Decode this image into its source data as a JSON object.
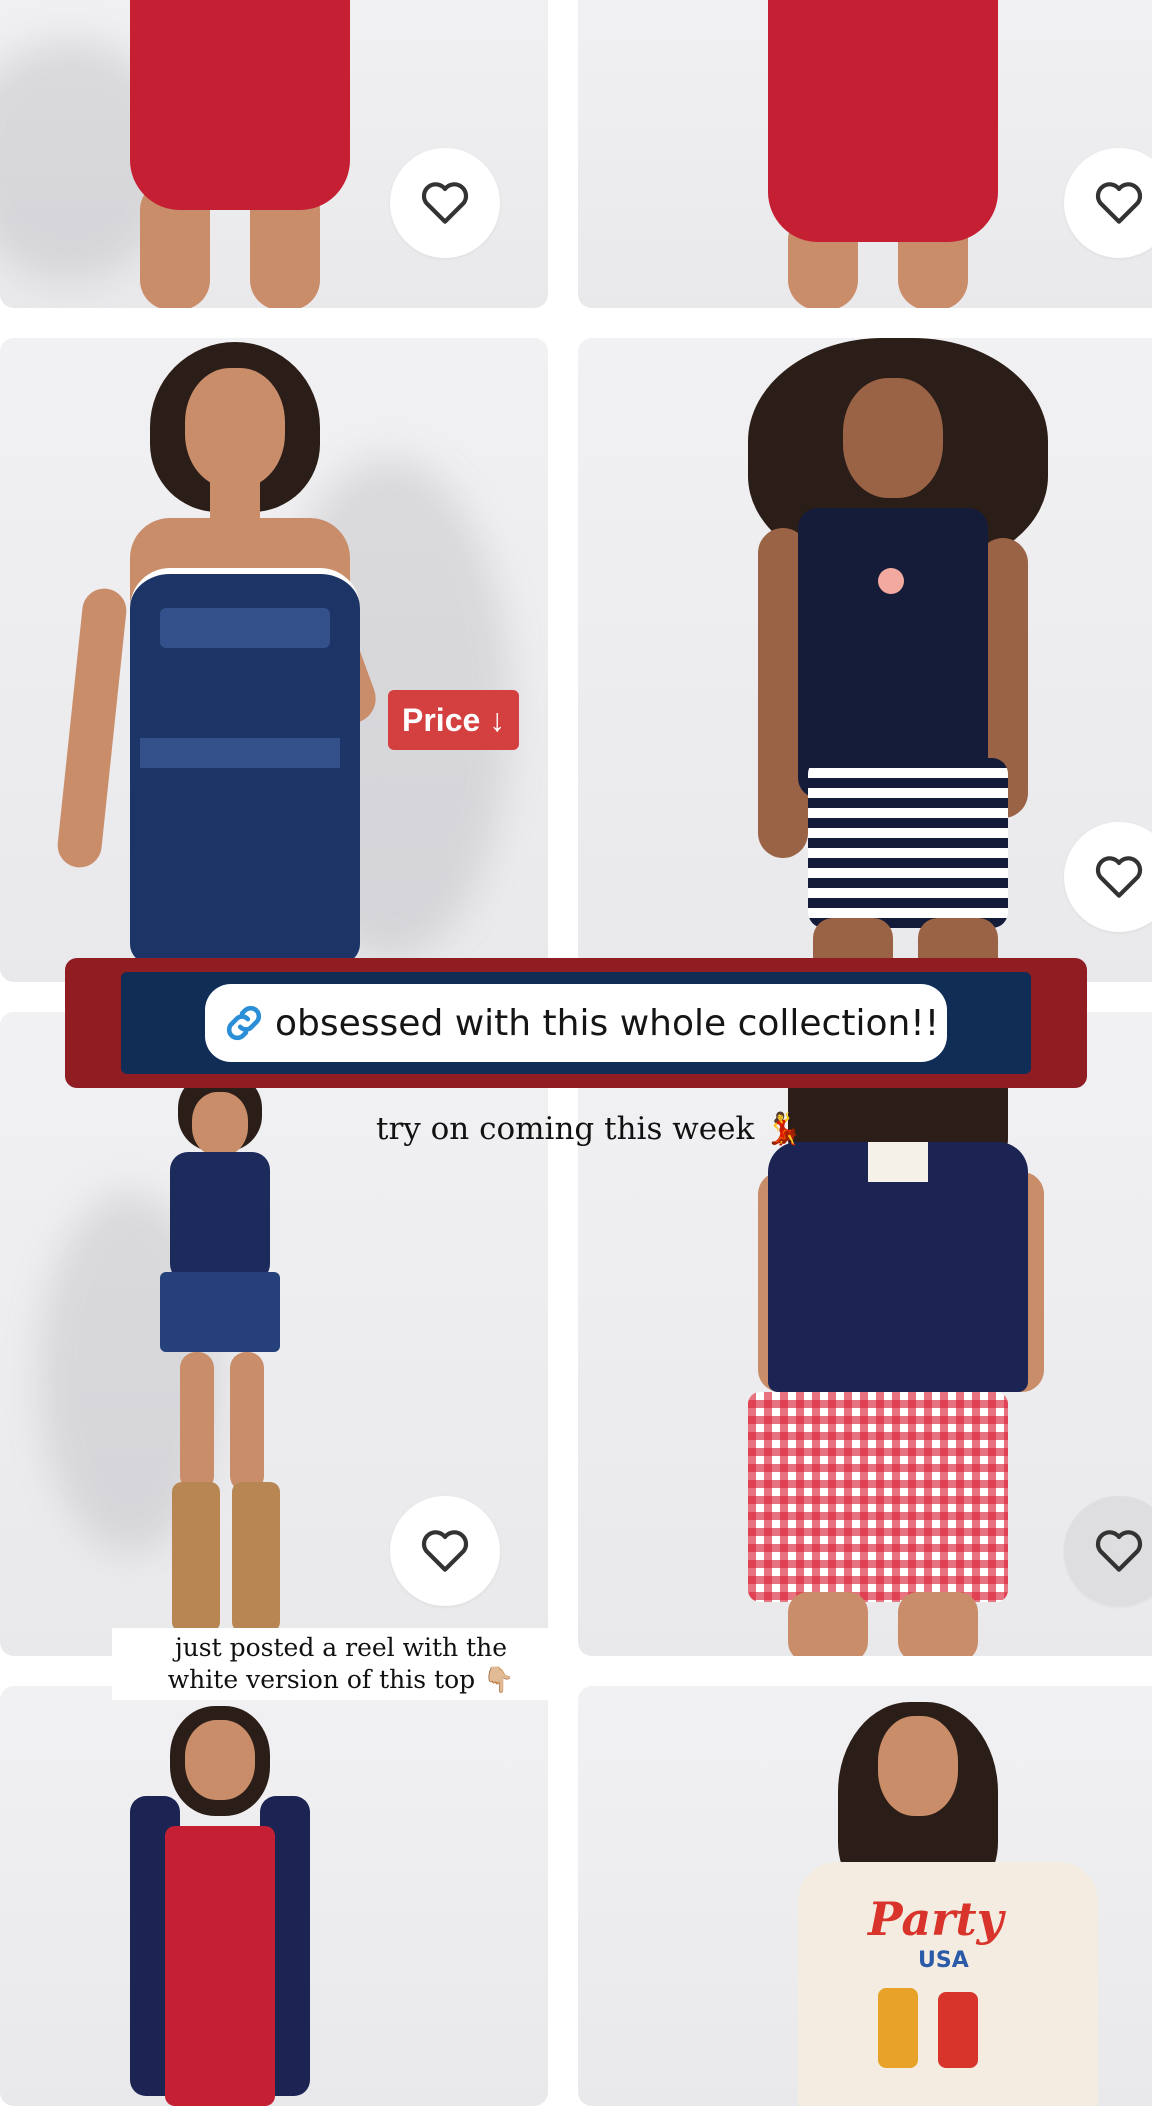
{
  "products": [
    {
      "id": "row1-left",
      "outfit": "red anchor print romper",
      "favorite_icon": "heart-outline-icon"
    },
    {
      "id": "row1-right",
      "outfit": "red anchor print romper",
      "favorite_icon": "heart-outline-icon"
    },
    {
      "id": "row2-left",
      "outfit": "navy bandana print romper",
      "badge": "Price ↓",
      "favorite_icon": "heart-outline-icon"
    },
    {
      "id": "row2-right",
      "outfit": "navy tank with striped shorts",
      "favorite_icon": "heart-outline-icon"
    },
    {
      "id": "row3-left",
      "outfit": "navy halter with bandana skirt",
      "favorite_icon": "heart-outline-icon"
    },
    {
      "id": "row3-right",
      "outfit": "navy polo with red gingham shorts",
      "favorite_icon": "heart-outline-icon"
    },
    {
      "id": "row4-left",
      "outfit": "red tube top set"
    },
    {
      "id": "row4-right",
      "outfit": "Party USA graphic tee",
      "tee_text": "Party",
      "tee_subtext": "USA"
    }
  ],
  "link_sticker": {
    "icon": "link-icon",
    "text": "obsessed with this whole collection!!"
  },
  "captions": {
    "try_on": "try on coming this week 💃",
    "reel_line1": "just posted a reel with the",
    "reel_line2": "white version of this top 👇🏼"
  },
  "colors": {
    "banner_red": "#8f1d22",
    "banner_navy": "#0f2d55",
    "badge_red": "#d43f3f",
    "heart_stroke": "#333333"
  }
}
